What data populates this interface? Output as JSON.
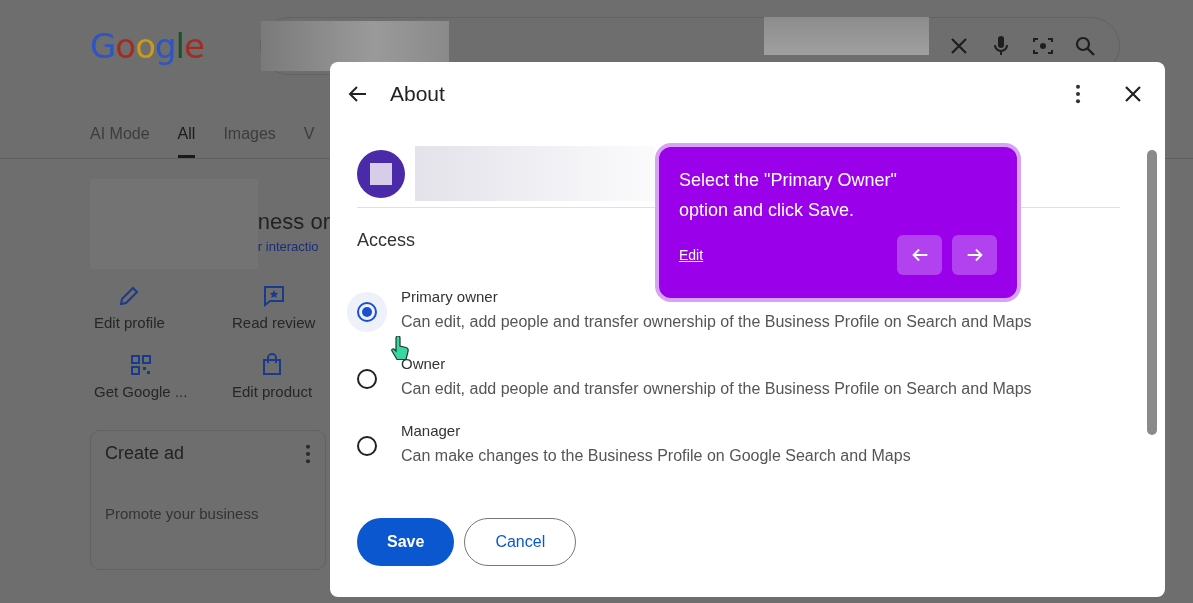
{
  "page": {
    "logo": "Google",
    "tabs": [
      {
        "label": "AI Mode",
        "selected": false
      },
      {
        "label": "All",
        "selected": true
      },
      {
        "label": "Images",
        "selected": false
      },
      {
        "label": "V",
        "selected": false
      }
    ],
    "heading_fragment": "ness or",
    "link_fragment": "r interactio",
    "actions": [
      {
        "label": "Edit profile",
        "kind": "pencil"
      },
      {
        "label": "Read review",
        "kind": "review"
      },
      {
        "label": "Get Google ...",
        "kind": "qr"
      },
      {
        "label": "Edit product",
        "kind": "bag"
      }
    ],
    "card": {
      "title": "Create ad",
      "text": "Promote your business"
    }
  },
  "dialog": {
    "title": "About",
    "section": "Access",
    "options": [
      {
        "label": "Primary owner",
        "description": "Can edit, add people and transfer ownership of the Business Profile on Search and Maps",
        "selected": true
      },
      {
        "label": "Owner",
        "description": "Can edit, add people and transfer ownership of the Business Profile on Search and Maps",
        "selected": false
      },
      {
        "label": "Manager",
        "description": "Can make changes to the Business Profile on Google Search and Maps",
        "selected": false
      }
    ],
    "buttons": [
      {
        "label": "Save",
        "kind": "primary"
      },
      {
        "label": "Cancel",
        "kind": "outline"
      }
    ]
  },
  "tooltip": {
    "text": "Select the \"Primary Owner\" option and click Save.",
    "link": "Edit"
  }
}
